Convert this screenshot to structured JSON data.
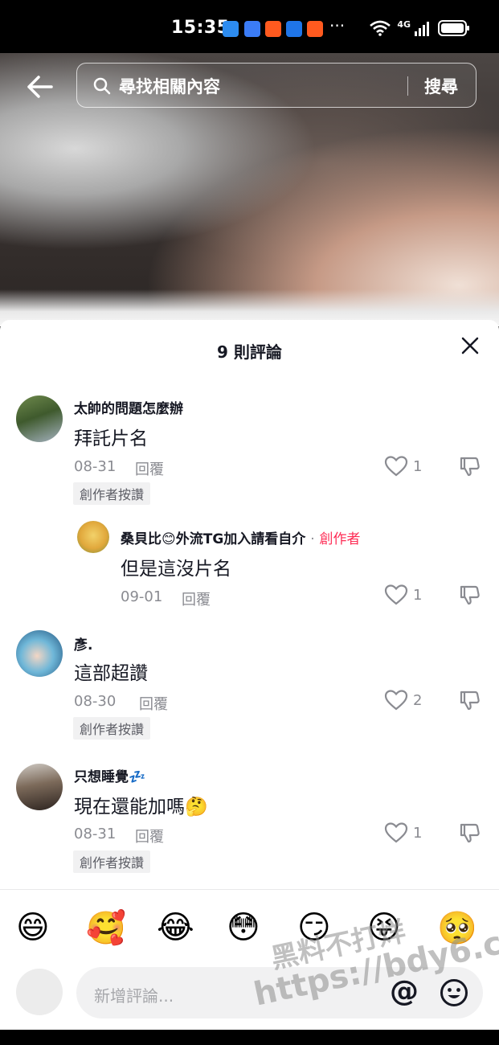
{
  "status_bar": {
    "time": "15:35",
    "more": "···",
    "network": "4G"
  },
  "search": {
    "placeholder": "尋找相關內容",
    "button_label": "搜尋"
  },
  "comments_sheet": {
    "title": "9 則評論",
    "comments": [
      {
        "username": "太帥的問題怎麼辦",
        "text": "拜託片名",
        "date": "08-31",
        "reply_label": "回覆",
        "likes": "1",
        "badge": "創作者按讚"
      },
      {
        "username": "彥.",
        "text": "這部超讚",
        "date": "08-30",
        "reply_label": "回覆",
        "likes": "2",
        "badge": "創作者按讚"
      },
      {
        "username": "只想睡覺💤",
        "text": "現在還能加嗎🤔",
        "date": "08-31",
        "reply_label": "回覆",
        "likes": "1",
        "badge": "創作者按讚"
      }
    ],
    "reply": {
      "username": "桑貝比😊外流TG加入請看自介",
      "separator": "·",
      "creator_tag": "創作者",
      "text": "但是這沒片名",
      "date": "09-01",
      "reply_label": "回覆",
      "likes": "1"
    }
  },
  "emoji_bar": [
    "😄",
    "🥰",
    "😂",
    "😳",
    "😏",
    "😝",
    "🥺"
  ],
  "comment_input": {
    "placeholder": "新增評論...",
    "at_label": "@"
  },
  "watermark": {
    "line1": "黑料不打烊",
    "line2": "https://bdy6.co"
  },
  "colors": {
    "creator_tag": "#fe2c55",
    "text_primary": "#161823",
    "text_secondary": "#8a8b91"
  }
}
